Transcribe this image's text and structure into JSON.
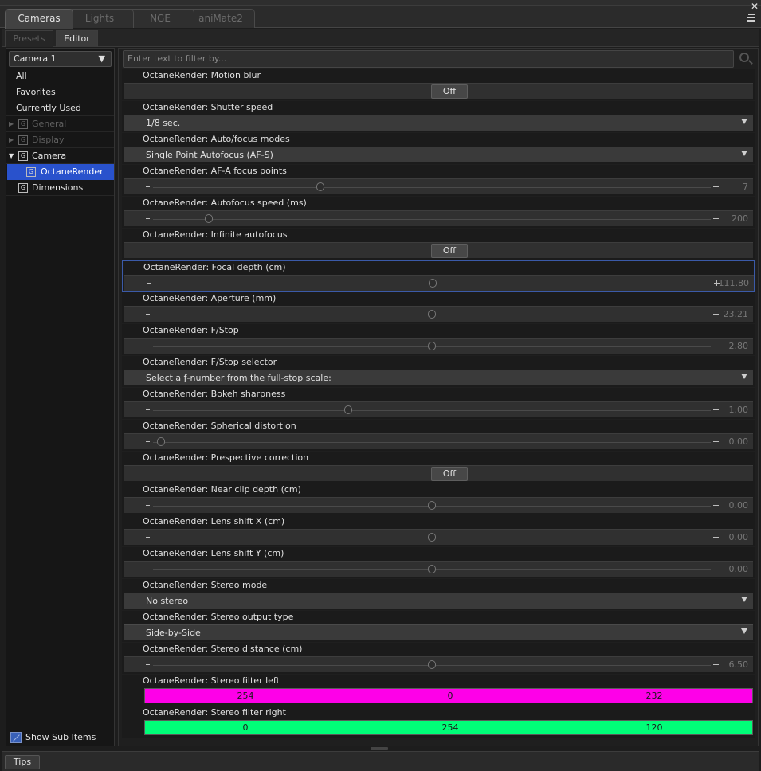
{
  "tabs": [
    {
      "label": "Cameras",
      "active": true
    },
    {
      "label": "Lights",
      "active": false
    },
    {
      "label": "NGE",
      "active": false
    },
    {
      "label": "aniMate2",
      "active": false
    }
  ],
  "close_glyph": "✕",
  "subtabs": [
    {
      "label": "Presets",
      "active": false
    },
    {
      "label": "Editor",
      "active": true
    }
  ],
  "sidebar": {
    "camera_select": "Camera 1",
    "items": [
      {
        "label": "All",
        "type": "plain",
        "state": "normal"
      },
      {
        "label": "Favorites",
        "type": "plain",
        "state": "normal"
      },
      {
        "label": "Currently Used",
        "type": "plain",
        "state": "normal"
      },
      {
        "label": "General",
        "type": "group",
        "expanded": false,
        "state": "dim"
      },
      {
        "label": "Display",
        "type": "group",
        "expanded": false,
        "state": "dim"
      },
      {
        "label": "Camera",
        "type": "group",
        "expanded": true,
        "state": "normal"
      },
      {
        "label": "OctaneRender",
        "type": "child",
        "state": "selected"
      },
      {
        "label": "Dimensions",
        "type": "group-leaf",
        "state": "normal"
      }
    ],
    "group_icon_glyph": "G",
    "show_sub_items": {
      "label": "Show Sub Items",
      "checked": true
    }
  },
  "filter": {
    "placeholder": "Enter text to filter by..."
  },
  "properties": [
    {
      "label": "OctaneRender: Motion blur",
      "type": "toggle",
      "value": "Off"
    },
    {
      "label": "OctaneRender: Shutter speed",
      "type": "dropdown",
      "value": "1/8 sec."
    },
    {
      "label": "OctaneRender: Auto/focus modes",
      "type": "dropdown",
      "value": "Single Point Autofocus (AF-S)"
    },
    {
      "label": "OctaneRender: AF-A focus points",
      "type": "slider",
      "value": "7",
      "fraction": 0.3
    },
    {
      "label": "OctaneRender: Autofocus speed (ms)",
      "type": "slider",
      "value": "200",
      "fraction": 0.1
    },
    {
      "label": "OctaneRender: Infinite autofocus",
      "type": "toggle",
      "value": "Off"
    },
    {
      "label": "OctaneRender: Focal depth (cm)",
      "type": "slider",
      "value": "111.80",
      "fraction": 0.5,
      "focused": true
    },
    {
      "label": "OctaneRender: Aperture (mm)",
      "type": "slider",
      "value": "23.21",
      "fraction": 0.5
    },
    {
      "label": "OctaneRender: F/Stop",
      "type": "slider",
      "value": "2.80",
      "fraction": 0.5
    },
    {
      "label": "OctaneRender: F/Stop selector",
      "type": "dropdown",
      "value": "Select a ƒ-number from the full-stop scale:"
    },
    {
      "label": "OctaneRender: Bokeh sharpness",
      "type": "slider",
      "value": "1.00",
      "fraction": 0.35
    },
    {
      "label": "OctaneRender: Spherical distortion",
      "type": "slider",
      "value": "0.00",
      "fraction": 0.0
    },
    {
      "label": "OctaneRender: Prespective correction",
      "type": "toggle",
      "value": "Off"
    },
    {
      "label": "OctaneRender: Near clip depth (cm)",
      "type": "slider",
      "value": "0.00",
      "fraction": 0.5
    },
    {
      "label": "OctaneRender: Lens shift X (cm)",
      "type": "slider",
      "value": "0.00",
      "fraction": 0.5
    },
    {
      "label": "OctaneRender: Lens shift Y (cm)",
      "type": "slider",
      "value": "0.00",
      "fraction": 0.5
    },
    {
      "label": "OctaneRender: Stereo mode",
      "type": "dropdown",
      "value": "No stereo"
    },
    {
      "label": "OctaneRender: Stereo output type",
      "type": "dropdown",
      "value": "Side-by-Side"
    },
    {
      "label": "OctaneRender: Stereo distance (cm)",
      "type": "slider",
      "value": "6.50",
      "fraction": 0.5
    },
    {
      "label": "OctaneRender: Stereo filter left",
      "type": "color",
      "rgb": [
        "254",
        "0",
        "232"
      ],
      "color": "#fe00e8"
    },
    {
      "label": "OctaneRender: Stereo filter right",
      "type": "color",
      "rgb": [
        "0",
        "254",
        "120"
      ],
      "color": "#00fe78"
    }
  ],
  "status": {
    "tips_label": "Tips"
  },
  "colors": {
    "selection": "#2952cc",
    "focus_border": "#3b5aa8"
  }
}
